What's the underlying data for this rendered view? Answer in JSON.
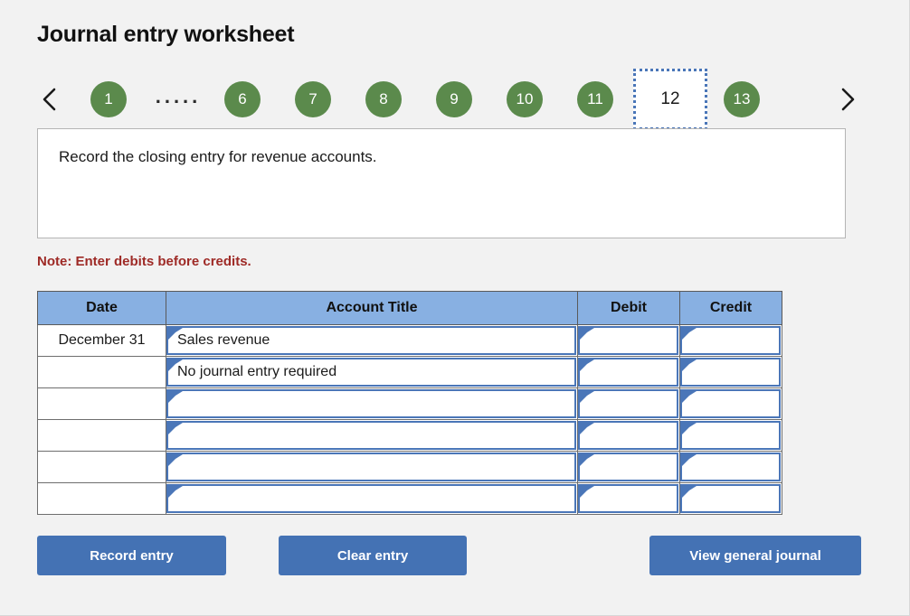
{
  "page": {
    "title": "Journal entry worksheet"
  },
  "stepnav": {
    "prev_icon": "chevron-left-icon",
    "next_icon": "chevron-right-icon",
    "steps": [
      {
        "label": "1",
        "state": "complete"
      },
      {
        "label": ".....",
        "state": "ellipsis"
      },
      {
        "label": "6",
        "state": "complete"
      },
      {
        "label": "7",
        "state": "complete"
      },
      {
        "label": "8",
        "state": "complete"
      },
      {
        "label": "9",
        "state": "complete"
      },
      {
        "label": "10",
        "state": "complete"
      },
      {
        "label": "11",
        "state": "complete"
      },
      {
        "label": "12",
        "state": "current"
      },
      {
        "label": "13",
        "state": "complete"
      }
    ],
    "current_step": "12",
    "complete_color": "#5b8a4c",
    "current_border_color": "#4a76b8"
  },
  "instruction": {
    "text": "Record the closing entry for revenue accounts."
  },
  "note": {
    "text": "Note: Enter debits before credits.",
    "color": "#9e2a26"
  },
  "journal": {
    "header_color": "#88b0e2",
    "columns": [
      "Date",
      "Account Title",
      "Debit",
      "Credit"
    ],
    "rows": [
      {
        "date": "December 31",
        "account": "Sales revenue",
        "debit": "",
        "credit": ""
      },
      {
        "date": "",
        "account": "No journal entry required",
        "debit": "",
        "credit": ""
      },
      {
        "date": "",
        "account": "",
        "debit": "",
        "credit": ""
      },
      {
        "date": "",
        "account": "",
        "debit": "",
        "credit": ""
      },
      {
        "date": "",
        "account": "",
        "debit": "",
        "credit": ""
      },
      {
        "date": "",
        "account": "",
        "debit": "",
        "credit": ""
      }
    ]
  },
  "buttons": {
    "record": "Record entry",
    "clear": "Clear entry",
    "view": "View general journal",
    "color": "#4472b4"
  }
}
